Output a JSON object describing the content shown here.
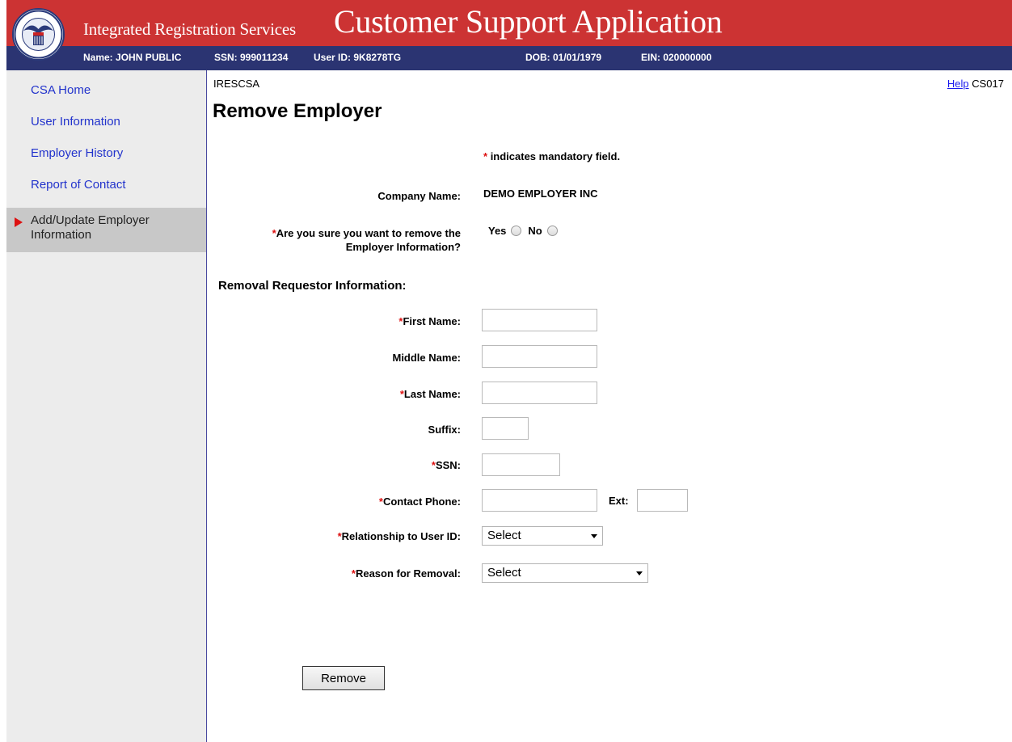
{
  "header": {
    "brand": "Integrated Registration Services",
    "app_title": "Customer Support Application",
    "seal_icon": "ssa-seal-icon",
    "info": {
      "name": "Name: JOHN PUBLIC",
      "ssn": "SSN: 999011234",
      "user_id": "User ID: 9K8278TG",
      "dob": "DOB: 01/01/1979",
      "ein": "EIN: 020000000"
    }
  },
  "sidebar": {
    "items": [
      {
        "label": "CSA Home"
      },
      {
        "label": "User Information"
      },
      {
        "label": "Employer History"
      },
      {
        "label": "Report of Contact"
      },
      {
        "label": "Add/Update Employer Information"
      }
    ]
  },
  "page": {
    "crumb": "IRESCSA",
    "help_label": "Help",
    "page_code": "CS017",
    "title": "Remove Employer",
    "mandatory_star": "*",
    "mandatory_note": "indicates mandatory field.",
    "company_label": "Company Name:",
    "company_value": "DEMO EMPLOYER INC",
    "confirm_line1": "Are you sure you want to remove the",
    "confirm_line2": "Employer Information?",
    "yes_label": "Yes",
    "no_label": "No",
    "section_title": "Removal Requestor Information:",
    "fields": {
      "first_name": "First Name:",
      "middle_name": "Middle Name:",
      "last_name": "Last Name:",
      "suffix": "Suffix:",
      "ssn": "SSN:",
      "contact_phone": "Contact Phone:",
      "ext": "Ext:",
      "relationship": "Relationship to User ID:",
      "reason": "Reason for Removal:"
    },
    "relationship_selected": "Select",
    "reason_selected": "Select",
    "remove_button": "Remove"
  },
  "colors": {
    "banner": "#cc3333",
    "infobar": "#2b3472",
    "required": "#dd1111",
    "link": "#2233cc"
  }
}
